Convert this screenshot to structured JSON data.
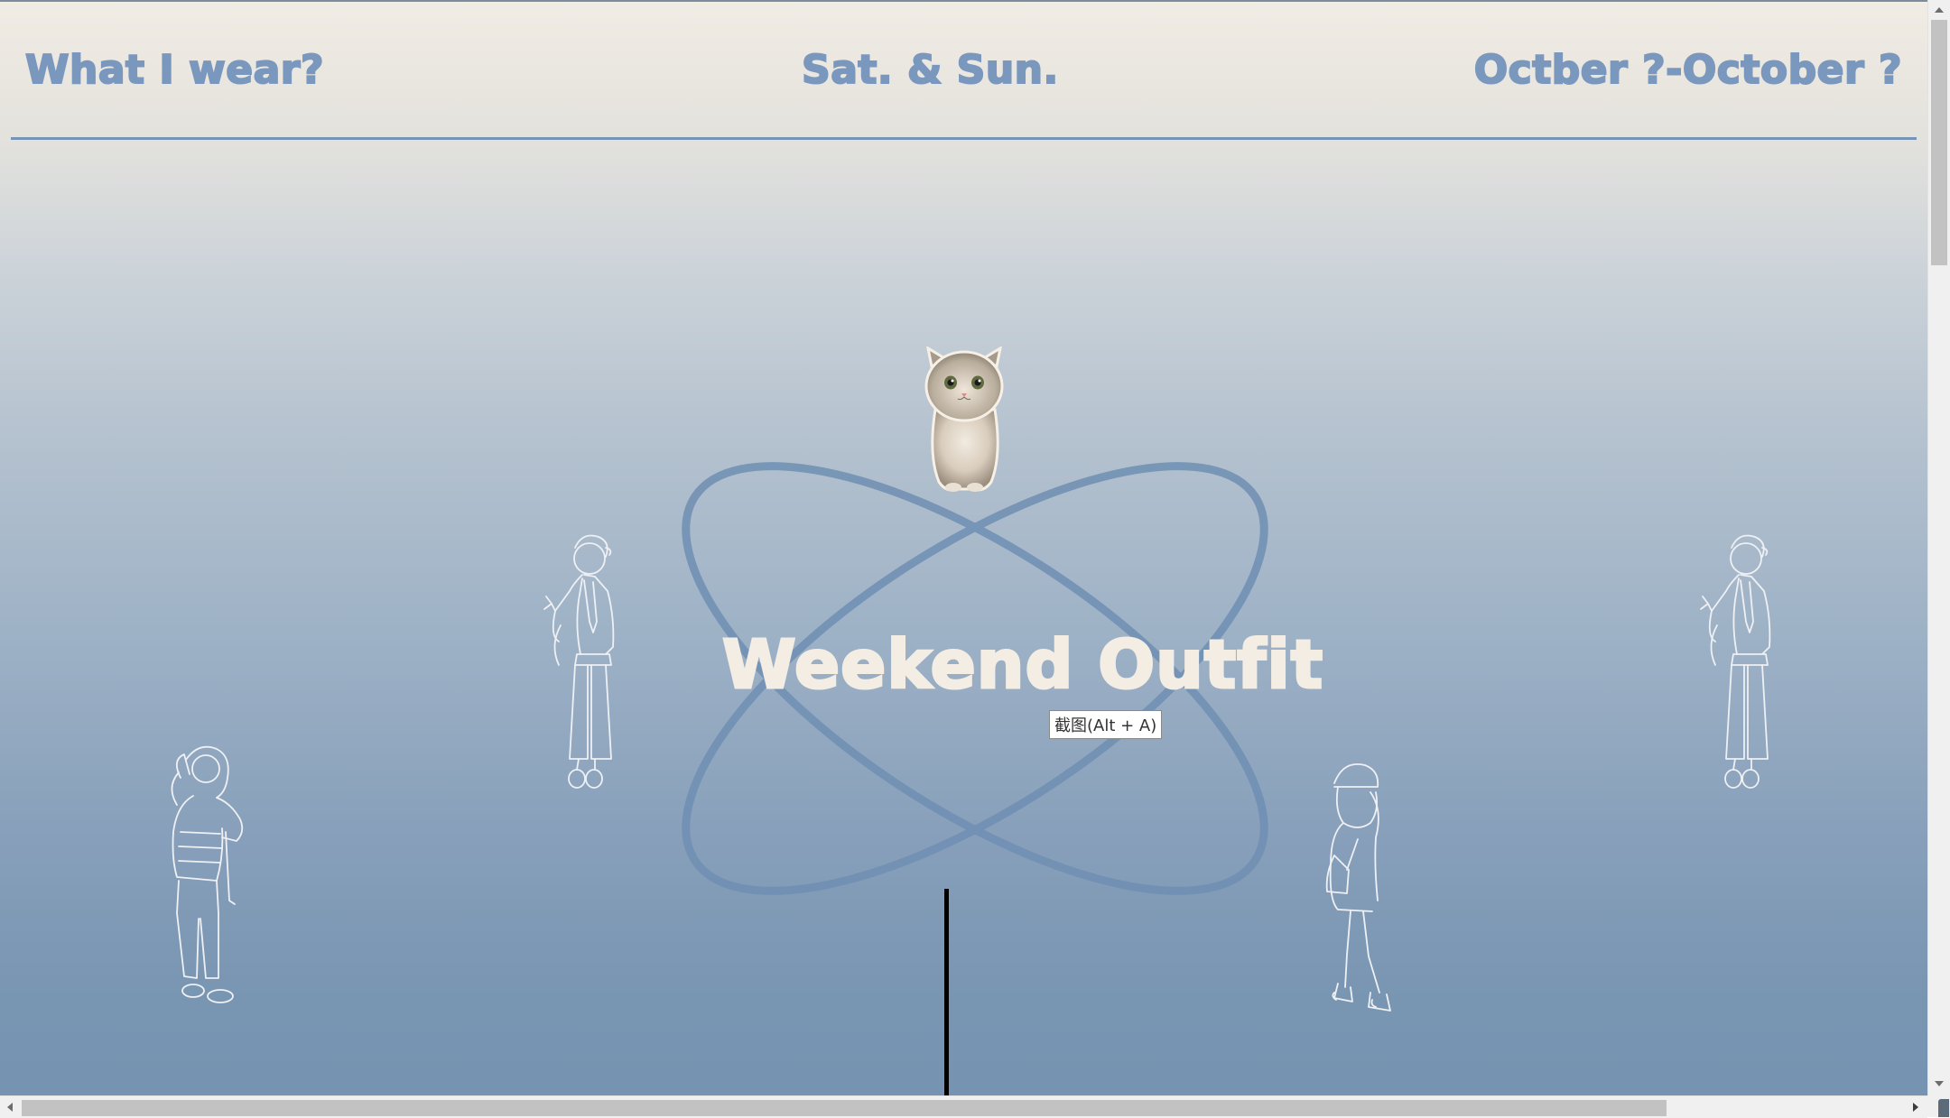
{
  "header": {
    "site_title": "What I wear?",
    "weekend_days": "Sat. & Sun.",
    "date_range": "Octber ?-October ?"
  },
  "hero": {
    "title": "Weekend Outfit"
  },
  "tooltip": {
    "text": "截图(Alt + A)"
  },
  "colors": {
    "accent_blue": "#7a97bd",
    "rule_blue": "#7593b3",
    "hero_text": "#f3ede4",
    "gradient_top": "#f1ece4",
    "gradient_bottom": "#7694b1"
  },
  "icons": {
    "cat": "cat-photo",
    "figures": [
      "girl-sketch-waving",
      "girl-sketch-waving",
      "girl-sketch-hooded",
      "girl-sketch-walking"
    ],
    "scroll_up": "scroll-up-arrow-icon",
    "scroll_down": "scroll-down-arrow-icon",
    "scroll_left": "scroll-left-arrow-icon",
    "scroll_right": "scroll-right-arrow-icon"
  }
}
